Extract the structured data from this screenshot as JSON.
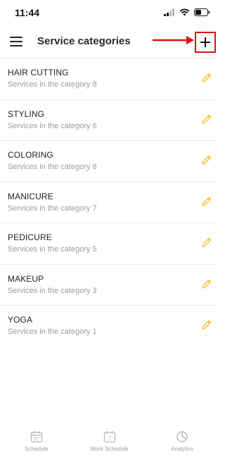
{
  "status_bar": {
    "time": "11:44"
  },
  "header": {
    "title": "Service categories",
    "menu_icon": "hamburger-menu-icon",
    "add_icon": "plus-icon",
    "annotation_color": "#e01010"
  },
  "categories": [
    {
      "name": "HAIR CUTTING",
      "subtitle": "Services in the category 8"
    },
    {
      "name": "STYLING",
      "subtitle": "Services in the category 6"
    },
    {
      "name": "COLORING",
      "subtitle": "Services in the category 6"
    },
    {
      "name": "MANICURE",
      "subtitle": "Services in the category 7"
    },
    {
      "name": "PEDICURE",
      "subtitle": "Services in the category 5"
    },
    {
      "name": "MAKEUP",
      "subtitle": "Services in the category 3"
    },
    {
      "name": "YOGA",
      "subtitle": "Services in the category 1"
    }
  ],
  "edit_icon_color": "#f2c230",
  "tabbar": {
    "tabs": [
      {
        "label": "Schedule",
        "icon": "calendar-icon"
      },
      {
        "label": "Work Schedule",
        "icon": "calendar-7-icon",
        "icon_text": "7"
      },
      {
        "label": "Analytics",
        "icon": "pie-chart-icon"
      }
    ]
  }
}
